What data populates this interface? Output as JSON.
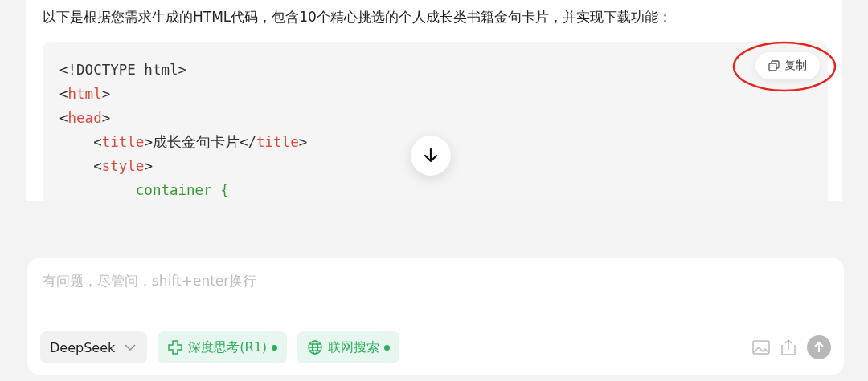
{
  "message": {
    "intro": "以下是根据您需求生成的HTML代码，包含10个精心挑选的个人成长类书籍金句卡片，并实现下载功能：",
    "copy_button": "复制",
    "code_lines": [
      [
        {
          "kind": "plain",
          "text": "<!DOCTYPE html>"
        }
      ],
      [
        {
          "kind": "plain",
          "text": "<"
        },
        {
          "kind": "tag",
          "text": "html"
        },
        {
          "kind": "plain",
          "text": ">"
        }
      ],
      [
        {
          "kind": "plain",
          "text": "<"
        },
        {
          "kind": "tag",
          "text": "head"
        },
        {
          "kind": "plain",
          "text": ">"
        }
      ],
      [
        {
          "kind": "plain",
          "text": "    <"
        },
        {
          "kind": "tag",
          "text": "title"
        },
        {
          "kind": "plain",
          "text": ">成长金句卡片</"
        },
        {
          "kind": "tag",
          "text": "title"
        },
        {
          "kind": "plain",
          "text": ">"
        }
      ],
      [
        {
          "kind": "plain",
          "text": "    <"
        },
        {
          "kind": "tag",
          "text": "style"
        },
        {
          "kind": "plain",
          "text": ">"
        }
      ],
      [
        {
          "kind": "selector",
          "text": "         container {"
        }
      ]
    ]
  },
  "composer": {
    "placeholder": "有问题，尽管问，shift+enter换行",
    "model": "DeepSeek",
    "toggles": [
      {
        "label": "深度思考(R1)",
        "kind": "think",
        "on": true
      },
      {
        "label": "联网搜索",
        "kind": "web",
        "on": true
      }
    ]
  }
}
